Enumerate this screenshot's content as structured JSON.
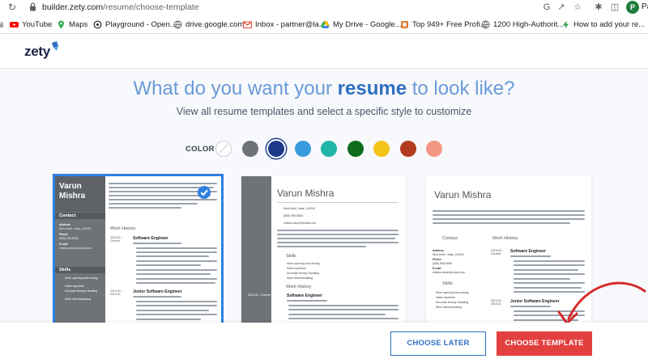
{
  "browser": {
    "url_host": "builder.zety.com",
    "url_path": "/resume/choose-template",
    "profile_initial": "P",
    "profile_text": "Pa",
    "bookmarks": [
      {
        "label": "YouTube",
        "icon": "youtube-icon",
        "color": "#ff0000"
      },
      {
        "label": "Maps",
        "icon": "maps-icon",
        "color": "#34a853"
      },
      {
        "label": "Playground - Open...",
        "icon": "openai-icon",
        "color": "#202124"
      },
      {
        "label": "drive.google.com",
        "icon": "globe-icon",
        "color": "#5f6368"
      },
      {
        "label": "Inbox - partner@la...",
        "icon": "gmail-icon",
        "color": "#ea4335"
      },
      {
        "label": "My Drive - Google...",
        "icon": "drive-icon",
        "color": "#fbbc04"
      },
      {
        "label": "Top 949+ Free Profi...",
        "icon": "bookmark-icon",
        "color": "#e07b39"
      },
      {
        "label": "1200 High-Authorit...",
        "icon": "globe-icon",
        "color": "#5f6368"
      },
      {
        "label": "How to add your re...",
        "icon": "bolt-icon",
        "color": "#2e9e44"
      }
    ]
  },
  "header": {
    "logo": "zety"
  },
  "main": {
    "headline_pre": "What do you want your ",
    "headline_bold": "resume",
    "headline_post": " to look like?",
    "subheadline": "View all resume templates and select a specific style to customize",
    "color_label": "COLOR",
    "colors": [
      "#ffffff",
      "#6f7378",
      "#1d3a8a",
      "#3a9bdc",
      "#1fb5a7",
      "#0f6b1e",
      "#f3c316",
      "#b33a1e",
      "#f39683"
    ],
    "selected_color": "#1d3a8a"
  },
  "templates": [
    {
      "name_first": "Varun",
      "name_last": "Mishra",
      "contact_heading": "Contact",
      "skills_heading": "Skills",
      "work_heading": "Work History",
      "job1": "Software Engineer",
      "job2": "Junior Software Engineer",
      "dates1": "2015-02 - Current",
      "dates2": "2013-04 - 2015-01",
      "address_label": "Address",
      "address": "New Delhi, India, 110034",
      "phone_label": "Phone",
      "phone": "(555) 555-5555",
      "email_label": "E-mail",
      "email": "mishra.varun@email.com",
      "skills": [
        "Store opening and closing",
        "Sales expertise",
        "Accurate Money Handling",
        "Store Merchandising"
      ],
      "selected": true
    },
    {
      "name": "Varun Mishra",
      "address": "New Delhi, India, 110034",
      "phone": "(555) 555-5555",
      "email": "mishra.varun@email.com",
      "skills_heading": "Skills",
      "work_heading": "Work History",
      "dates1": "2015-02 - Current",
      "job1": "Software Engineer",
      "skills": [
        "Store opening and closing",
        "Sales expertise",
        "Accurate Money Handling",
        "Store Merchandising"
      ]
    },
    {
      "name": "Varun Mishra",
      "contact_heading": "Contact",
      "work_heading": "Work History",
      "skills_heading": "Skills",
      "address_label": "Address",
      "address": "New Delhi, India, 110034",
      "phone_label": "Phone",
      "phone": "(555) 555-5555",
      "email_label": "E-mail",
      "email": "mishra.varun@email.com",
      "dates1": "2015-02 - Current",
      "dates2": "2013-04 - 2015-01",
      "job1": "Software Engineer",
      "job2": "Junior Software Engineer",
      "skills": [
        "Store opening and closing",
        "Sales expertise",
        "Accurate Money Handling",
        "Store Merchandising"
      ]
    }
  ],
  "footer": {
    "choose_later": "CHOOSE LATER",
    "choose_template": "CHOOSE TEMPLATE"
  }
}
